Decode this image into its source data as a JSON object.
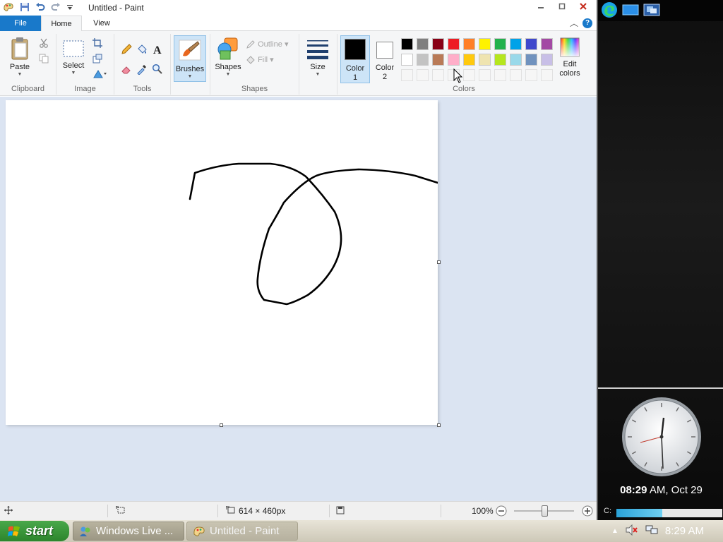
{
  "window": {
    "title": "Untitled - Paint"
  },
  "tabs": {
    "file": "File",
    "home": "Home",
    "view": "View"
  },
  "ribbon": {
    "clipboard": {
      "paste": "Paste",
      "group": "Clipboard"
    },
    "image": {
      "select": "Select",
      "group": "Image"
    },
    "tools": {
      "group": "Tools"
    },
    "brushes": {
      "label": "Brushes"
    },
    "shapes": {
      "shapes": "Shapes",
      "outline": "Outline",
      "fill": "Fill",
      "group": "Shapes"
    },
    "size": {
      "label": "Size"
    },
    "colors": {
      "color1_l1": "Color",
      "color1_l2": "1",
      "color2_l1": "Color",
      "color2_l2": "2",
      "edit_l1": "Edit",
      "edit_l2": "colors",
      "group": "Colors",
      "color1": "#000000",
      "color2": "#ffffff",
      "palette_row1": [
        "#000000",
        "#7f7f7f",
        "#880015",
        "#ed1c24",
        "#ff7f27",
        "#fff200",
        "#22b14c",
        "#00a2e8",
        "#3f48cc",
        "#a349a4"
      ],
      "palette_row2": [
        "#ffffff",
        "#c3c3c3",
        "#b97a57",
        "#ffaec9",
        "#ffc90e",
        "#efe4b0",
        "#b5e61d",
        "#99d9ea",
        "#7092be",
        "#c8bfe7"
      ]
    }
  },
  "status": {
    "canvas_size": "614 × 460px",
    "zoom": "100%"
  },
  "sidebar": {
    "time_bold": "08:29",
    "time_rest": " AM, Oct 29",
    "drive_label": "C:",
    "drive_usage": 0.43
  },
  "taskbar": {
    "start": "start",
    "task1": "Windows Live ...",
    "task2": "Untitled - Paint",
    "clock": "8:29 AM"
  }
}
